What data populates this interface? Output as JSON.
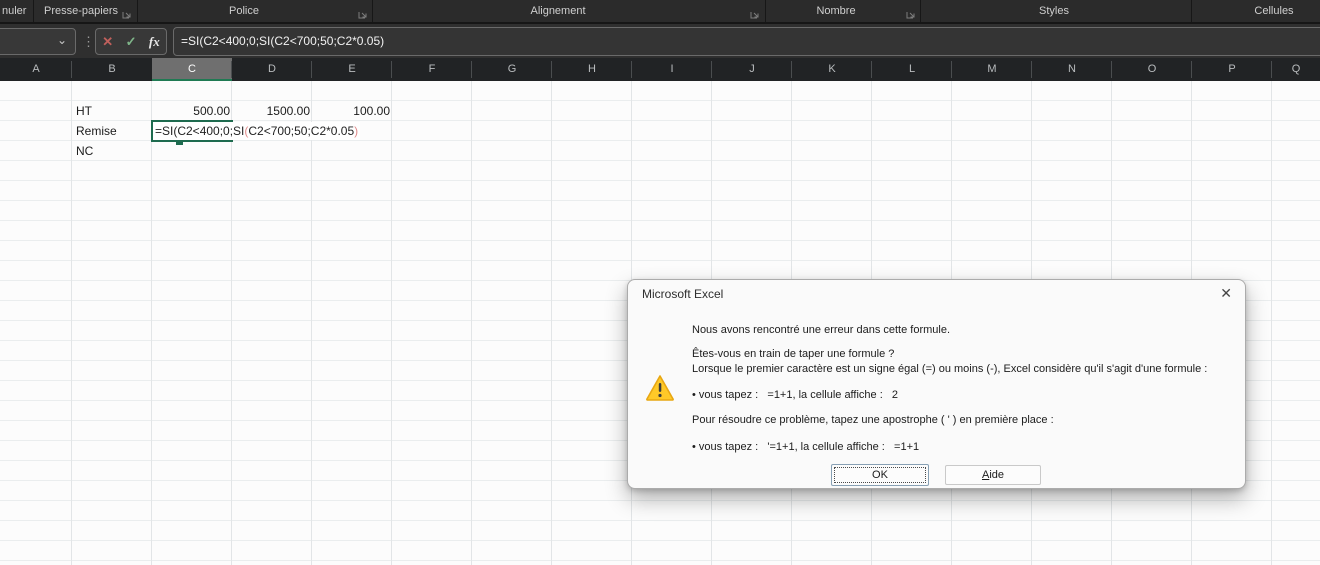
{
  "colors": {
    "dark_bar": "#2b2b2b",
    "edit_border_green": "#1e6b4f",
    "formula_paren_red": "#e08a8a",
    "selected_header_bg": "#6f6f6f",
    "selected_header_underline": "#1f7a53",
    "warning_fill": "#ffc928",
    "warning_stroke": "#e8a713"
  },
  "ribbon": {
    "groups": [
      {
        "label": "nuler"
      },
      {
        "label": "Presse-papiers"
      },
      {
        "label": "Police"
      },
      {
        "label": "Alignement"
      },
      {
        "label": "Nombre"
      },
      {
        "label": "Styles"
      },
      {
        "label": "Cellules"
      }
    ]
  },
  "formula_bar": {
    "name_box_value": "",
    "chevron": "⌄",
    "handle": "⋮",
    "cancel_icon": "✕",
    "enter_icon": "✓",
    "fx_icon": "fx",
    "formula": "=SI(C2<400;0;SI(C2<700;50;C2*0.05)"
  },
  "sheet": {
    "columns": [
      "A",
      "B",
      "C",
      "D",
      "E",
      "F",
      "G",
      "H",
      "I",
      "J",
      "K",
      "L",
      "M",
      "N",
      "O",
      "P",
      "Q"
    ],
    "selected_column": "C",
    "cells": [
      {
        "ref": "B2",
        "text": "HT"
      },
      {
        "ref": "C2",
        "text": "500.00"
      },
      {
        "ref": "D2",
        "text": "1500.00"
      },
      {
        "ref": "E2",
        "text": "100.00"
      },
      {
        "ref": "B3",
        "text": "Remise"
      },
      {
        "ref": "B4",
        "text": "NC"
      }
    ],
    "edit_cell": {
      "ref": "C3",
      "seg1": "=SI(C2<400;0;SI",
      "seg2": "(",
      "seg3": "C2<700;50;C2*0.05",
      "seg4": ")"
    }
  },
  "dialog": {
    "title": "Microsoft Excel",
    "close_icon": "✕",
    "line1": "Nous avons rencontré une erreur dans cette formule.",
    "line2": "Êtes-vous en train de taper une formule ?",
    "line3": "Lorsque le premier caractère est un signe égal (=) ou moins (-), Excel considère qu'il s'agit d'une formule :",
    "line4": "• vous tapez :   =1+1, la cellule affiche :   2",
    "line5": "Pour résoudre ce problème, tapez une apostrophe ( ' ) en première place :",
    "line6": "• vous tapez :   '=1+1, la cellule affiche :   =1+1",
    "ok_label": "OK",
    "help_key": "A",
    "help_rest": "ide"
  }
}
